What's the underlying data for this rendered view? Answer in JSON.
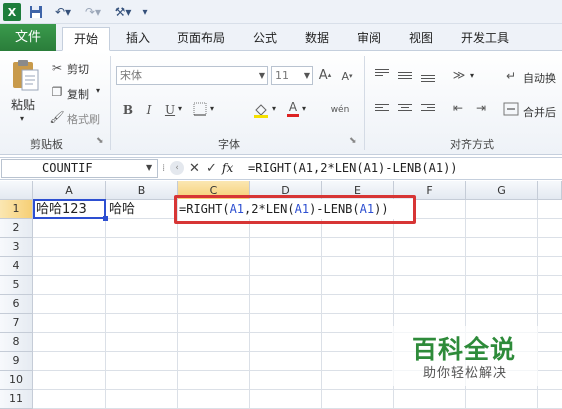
{
  "colors": {
    "file_tab": "#2a7d3a",
    "highlight_border": "#d73535",
    "reference_blue": "#2d4fd1",
    "selected_header": "#f6cf75",
    "watermark_green": "#2e8b3a"
  },
  "quick_access": {
    "icons": [
      "excel-icon",
      "save-icon",
      "undo-icon",
      "redo-icon",
      "tools-icon",
      "customize-icon"
    ]
  },
  "tabs": {
    "file": "文件",
    "home": "开始",
    "insert": "插入",
    "page_layout": "页面布局",
    "formulas": "公式",
    "data": "数据",
    "review": "审阅",
    "view": "视图",
    "developer": "开发工具"
  },
  "ribbon": {
    "clipboard": {
      "paste": "粘贴",
      "cut": "剪切",
      "copy": "复制",
      "format_painter": "格式刷",
      "group_title": "剪贴板"
    },
    "font": {
      "font_name": "宋体",
      "font_size": "11",
      "group_title": "字体",
      "bold": "B",
      "italic": "I",
      "underline": "U",
      "font_color": "A",
      "phonetic": "wén"
    },
    "alignment": {
      "wrap_text": "自动换",
      "merge": "合并后",
      "group_title": "对齐方式"
    }
  },
  "formula_bar": {
    "name_box": "COUNTIF",
    "cancel": "✕",
    "enter": "✓",
    "fx": "fx",
    "formula": "=RIGHT(A1,2*LEN(A1)-LENB(A1))"
  },
  "sheet": {
    "columns": [
      "A",
      "B",
      "C",
      "D",
      "E",
      "F",
      "G"
    ],
    "rows": [
      "1",
      "2",
      "3",
      "4",
      "5",
      "6",
      "7",
      "8",
      "9",
      "10",
      "11"
    ],
    "cells": {
      "A1": "哈哈123",
      "B1": "哈哈"
    },
    "edit_formula": {
      "part1": "=RIGHT(",
      "ref1": "A1",
      "part2": ",2*LEN(",
      "ref2": "A1",
      "part3": ")-LENB(",
      "ref3": "A1",
      "part4": "))"
    }
  },
  "watermark": {
    "title": "百科全说",
    "subtitle": "助你轻松解决"
  }
}
